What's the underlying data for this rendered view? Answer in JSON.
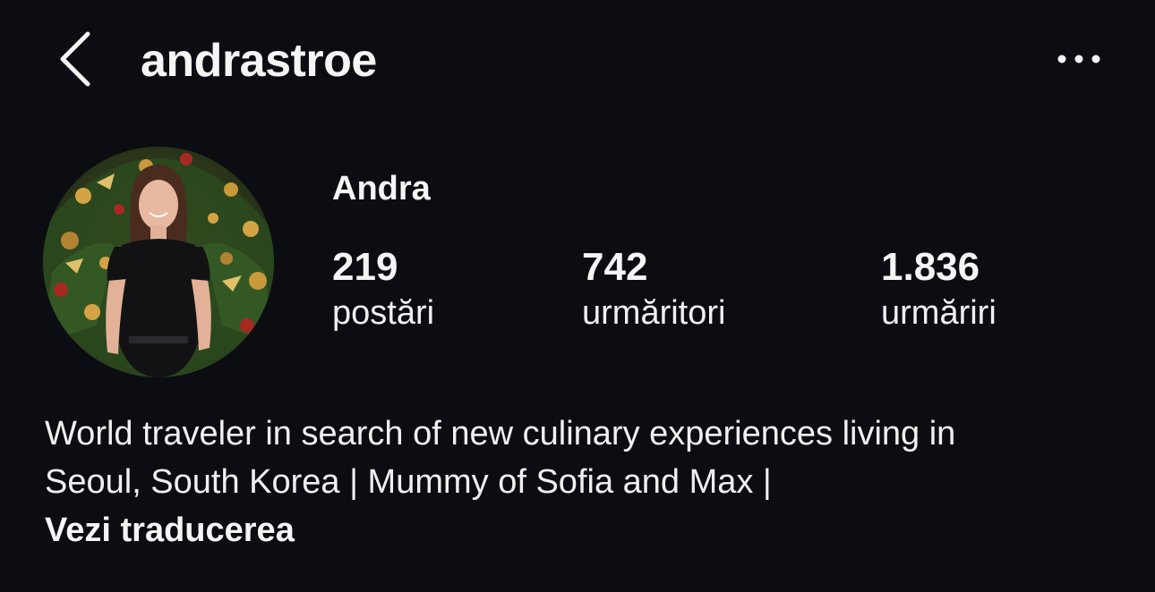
{
  "header": {
    "username": "andrastroe",
    "back_icon": "chevron-left-icon",
    "more_icon": "more-horizontal-icon"
  },
  "profile": {
    "display_name": "Andra",
    "stats": {
      "posts": {
        "value": "219",
        "label": "postări"
      },
      "followers": {
        "value": "742",
        "label": "urmăritori"
      },
      "following": {
        "value": "1.836",
        "label": "urmăriri"
      }
    },
    "bio": {
      "line1": "World traveler in search of new culinary experiences living in",
      "line2": "Seoul, South Korea | Mummy of Sofia and Max |",
      "translate": "Vezi traducerea"
    }
  },
  "colors": {
    "background": "#0b0d12",
    "text": "#f5f5f5"
  }
}
